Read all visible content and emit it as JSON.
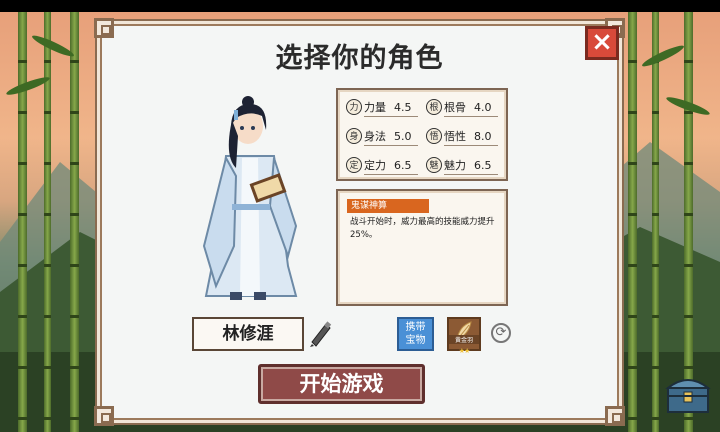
{
  "title": "选择你的角色",
  "close_icon": "×",
  "stats": [
    {
      "icon": "力",
      "name": "力量",
      "value": "4.5"
    },
    {
      "icon": "根",
      "name": "根骨",
      "value": "4.0"
    },
    {
      "icon": "身",
      "name": "身法",
      "value": "5.0"
    },
    {
      "icon": "悟",
      "name": "悟性",
      "value": "8.0"
    },
    {
      "icon": "定",
      "name": "定力",
      "value": "6.5"
    },
    {
      "icon": "魅",
      "name": "魅力",
      "value": "6.5"
    }
  ],
  "skill": {
    "name": "鬼谋神算",
    "description": "战斗开始时，威力最高的技能威力提升25%。"
  },
  "character": {
    "name": "林修涯"
  },
  "treasure_button": {
    "line1": "携带",
    "line2": "宝物"
  },
  "badge": {
    "label": "黄金羽",
    "stars": "★★"
  },
  "start_button": "开始游戏",
  "colors": {
    "panel_border": "#7d6553",
    "skill_tag": "#d9661f",
    "start_button": "#8f4a48",
    "close_button": "#d84a3a",
    "treasure_button": "#4a90d6"
  }
}
